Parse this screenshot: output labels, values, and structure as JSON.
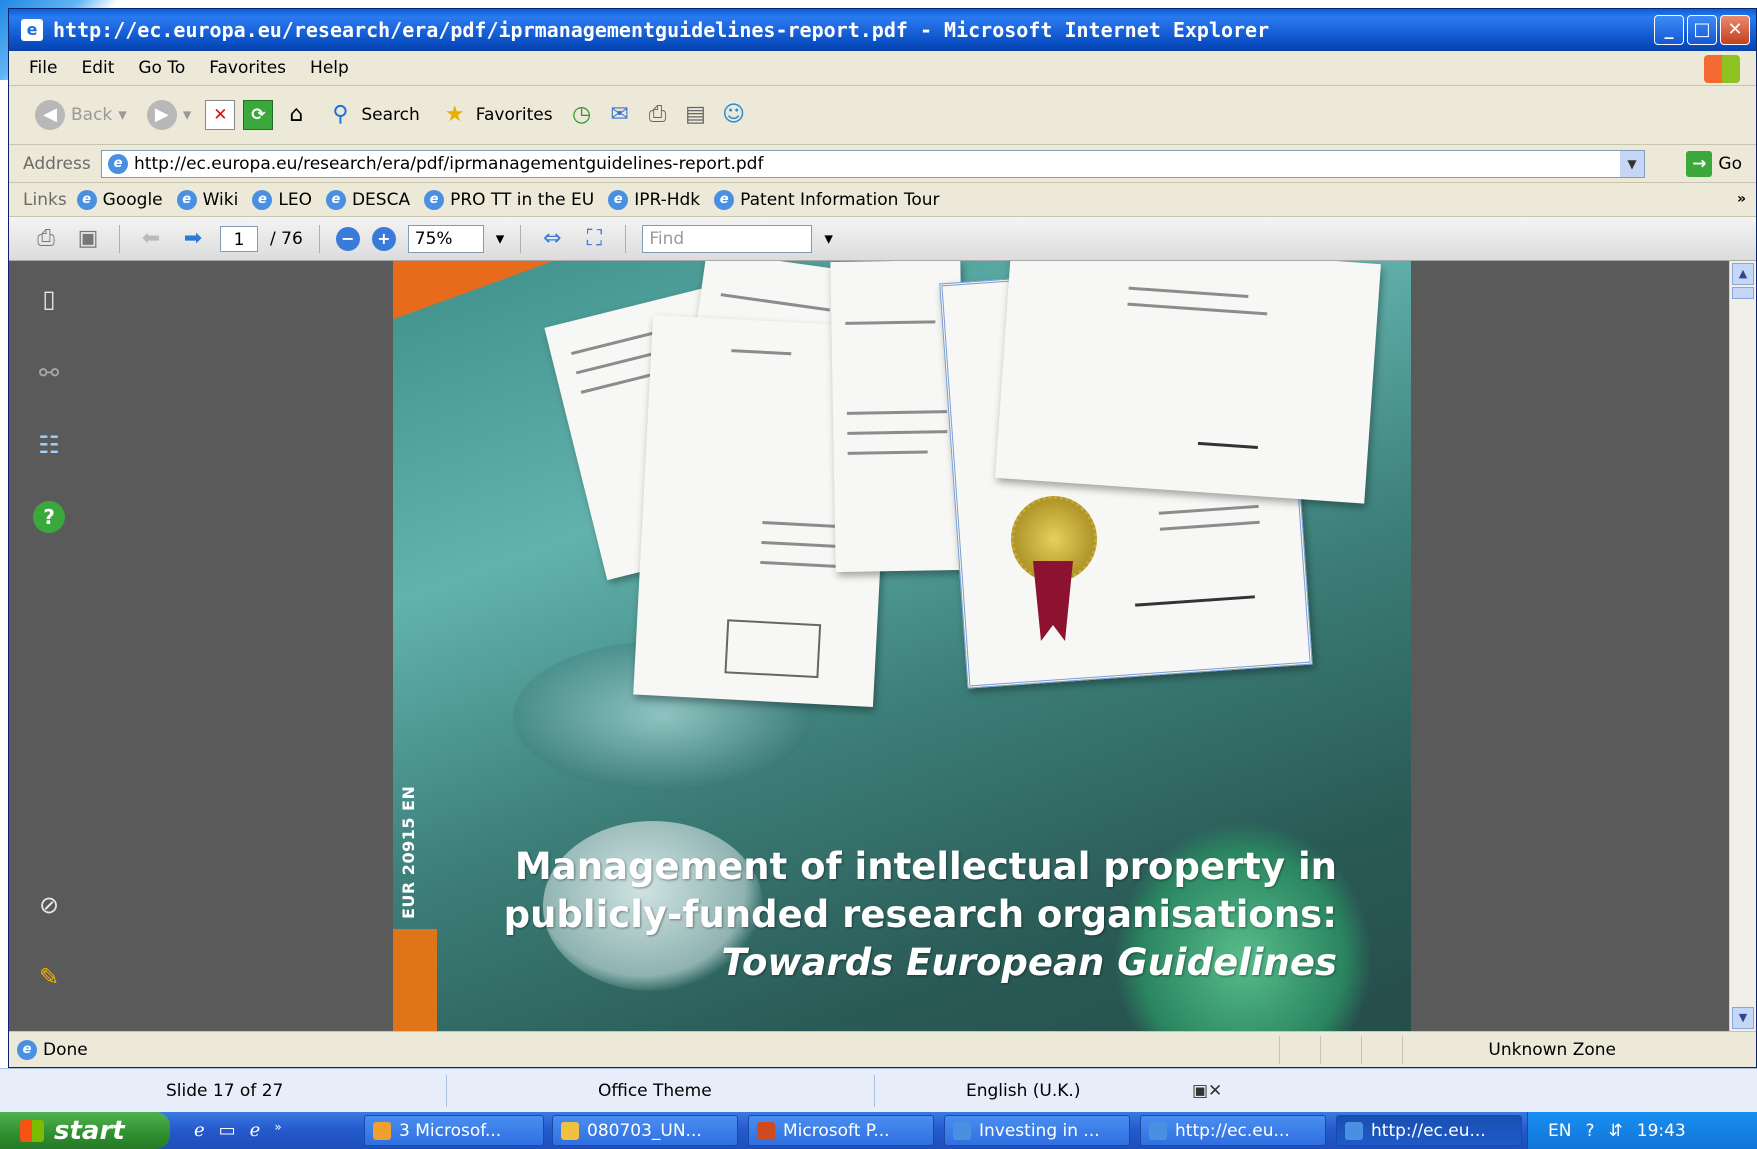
{
  "window": {
    "title": "http://ec.europa.eu/research/era/pdf/iprmanagementguidelines-report.pdf - Microsoft Internet Explorer",
    "minimize": "_",
    "maximize": "□",
    "close": "✕"
  },
  "menu": [
    "File",
    "Edit",
    "Go To",
    "Favorites",
    "Help"
  ],
  "toolbar": {
    "back_label": "Back",
    "search_label": "Search",
    "favorites_label": "Favorites"
  },
  "address": {
    "label": "Address",
    "url": "http://ec.europa.eu/research/era/pdf/iprmanagementguidelines-report.pdf",
    "go_label": "Go"
  },
  "links": {
    "label": "Links",
    "items": [
      "Google",
      "Wiki",
      "LEO",
      "DESCA",
      "PRO TT in the EU",
      "IPR-Hdk",
      "Patent Information Tour"
    ]
  },
  "pdf_toolbar": {
    "page_current": "1",
    "page_total": "/ 76",
    "zoom": "75%",
    "find_placeholder": "Find"
  },
  "cover": {
    "side_label": "EUR 20915 EN",
    "title_line1": "Management of intellectual property in",
    "title_line2": "publicly-funded research organisations:",
    "subtitle": "Towards European Guidelines"
  },
  "status": {
    "text": "Done",
    "zone": "Unknown Zone"
  },
  "powerpoint_status": {
    "slide": "Slide 17 of 27",
    "theme": "Office Theme",
    "language": "English (U.K.)"
  },
  "taskbar": {
    "start": "start",
    "tasks": [
      "3 Microsof...",
      "080703_UN...",
      "Microsoft P...",
      "Investing in ...",
      "http://ec.eu...",
      "http://ec.eu..."
    ],
    "lang": "EN",
    "time": "19:43"
  }
}
